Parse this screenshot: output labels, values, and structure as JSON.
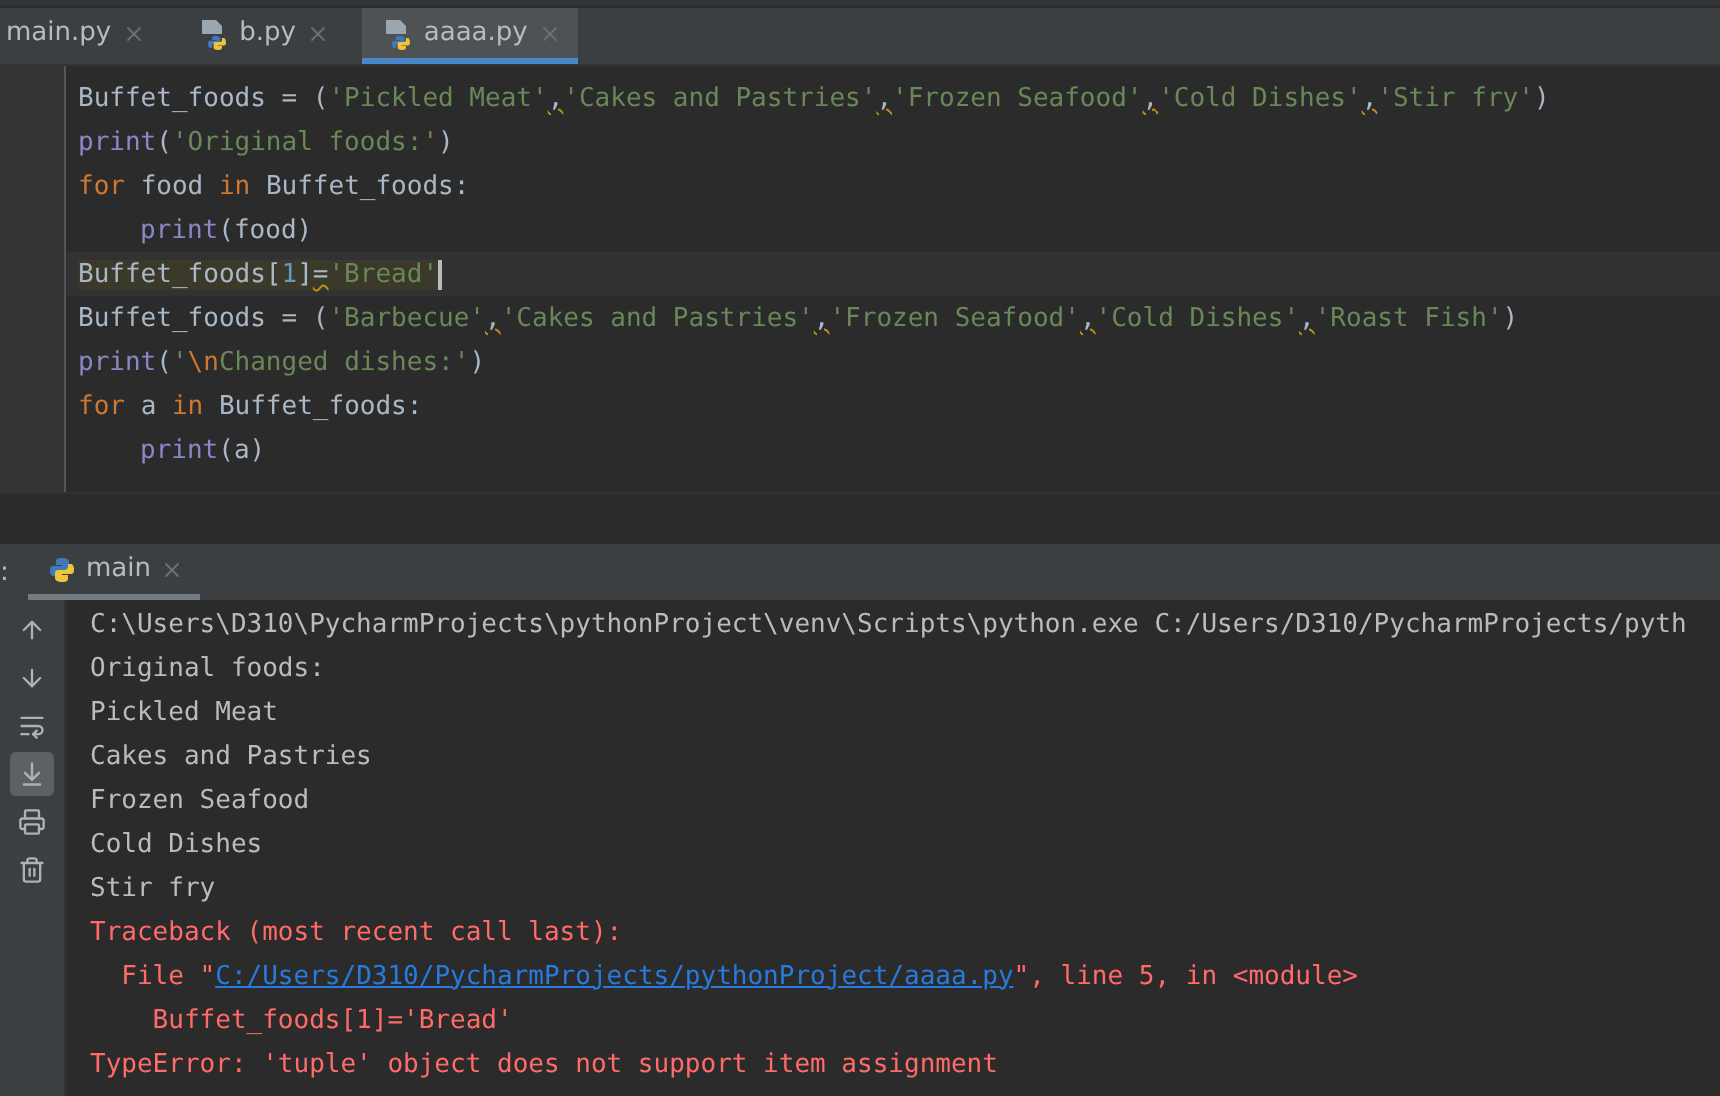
{
  "editor_tabs": [
    {
      "label": "main.py",
      "icon": false,
      "selected": false
    },
    {
      "label": "b.py",
      "icon": true,
      "selected": false
    },
    {
      "label": "aaaa.py",
      "icon": true,
      "selected": true
    }
  ],
  "code_lines": [
    {
      "current": false,
      "tokens": [
        {
          "kind": "name",
          "text": "Buffet_foods = "
        },
        {
          "kind": "paren",
          "text": "("
        },
        {
          "kind": "string",
          "text": "'Pickled Meat'"
        },
        {
          "kind": "warn",
          "text": ","
        },
        {
          "kind": "string",
          "text": "'Cakes and Pastries'"
        },
        {
          "kind": "warn",
          "text": ","
        },
        {
          "kind": "string",
          "text": "'Frozen Seafood'"
        },
        {
          "kind": "warn",
          "text": ","
        },
        {
          "kind": "string",
          "text": "'Cold Dishes'"
        },
        {
          "kind": "warn",
          "text": ","
        },
        {
          "kind": "string",
          "text": "'Stir fry'"
        },
        {
          "kind": "paren",
          "text": ")"
        }
      ]
    },
    {
      "current": false,
      "tokens": [
        {
          "kind": "builtin",
          "text": "print"
        },
        {
          "kind": "name",
          "text": "("
        },
        {
          "kind": "string",
          "text": "'Original foods:'"
        },
        {
          "kind": "name",
          "text": ")"
        }
      ]
    },
    {
      "current": false,
      "tokens": [
        {
          "kind": "keyword",
          "text": "for "
        },
        {
          "kind": "name",
          "text": "food "
        },
        {
          "kind": "keyword",
          "text": "in "
        },
        {
          "kind": "name",
          "text": "Buffet_foods:"
        }
      ],
      "children": [
        {
          "current": false,
          "tokens": [
            {
              "kind": "builtin",
              "text": "print"
            },
            {
              "kind": "name",
              "text": "(food)"
            }
          ]
        }
      ]
    },
    {
      "current": true,
      "tokens": [
        {
          "kind": "name",
          "text": "Buffet_foods["
        },
        {
          "kind": "number",
          "text": "1"
        },
        {
          "kind": "name",
          "text": "]"
        },
        {
          "kind": "warn",
          "text": "="
        },
        {
          "kind": "string",
          "text": "'Bread'"
        }
      ]
    },
    {
      "current": false,
      "tokens": [
        {
          "kind": "name",
          "text": "Buffet_foods = "
        },
        {
          "kind": "paren",
          "text": "("
        },
        {
          "kind": "string",
          "text": "'Barbecue'"
        },
        {
          "kind": "warn",
          "text": ","
        },
        {
          "kind": "string",
          "text": "'Cakes and Pastries'"
        },
        {
          "kind": "warn",
          "text": ","
        },
        {
          "kind": "string",
          "text": "'Frozen Seafood'"
        },
        {
          "kind": "warn",
          "text": ","
        },
        {
          "kind": "string",
          "text": "'Cold Dishes'"
        },
        {
          "kind": "warn",
          "text": ","
        },
        {
          "kind": "string",
          "text": "'Roast Fish'"
        },
        {
          "kind": "paren",
          "text": ")"
        }
      ]
    },
    {
      "current": false,
      "tokens": [
        {
          "kind": "builtin",
          "text": "print"
        },
        {
          "kind": "name",
          "text": "("
        },
        {
          "kind": "string",
          "text": "'"
        },
        {
          "kind": "escape",
          "text": "\\n"
        },
        {
          "kind": "string",
          "text": "Changed dishes:'"
        },
        {
          "kind": "name",
          "text": ")"
        }
      ]
    },
    {
      "current": false,
      "tokens": [
        {
          "kind": "keyword",
          "text": "for "
        },
        {
          "kind": "name",
          "text": "a "
        },
        {
          "kind": "keyword",
          "text": "in "
        },
        {
          "kind": "name",
          "text": "Buffet_foods:"
        }
      ],
      "children": [
        {
          "current": false,
          "tokens": [
            {
              "kind": "builtin",
              "text": "print"
            },
            {
              "kind": "name",
              "text": "(a)"
            }
          ]
        }
      ]
    }
  ],
  "run_panel": {
    "label": ":",
    "tab": {
      "label": "main",
      "selected": true
    }
  },
  "console_tools": [
    {
      "kind": "up",
      "on": false
    },
    {
      "kind": "down",
      "on": false
    },
    {
      "kind": "wrap",
      "on": false
    },
    {
      "kind": "scroll-end",
      "on": true
    },
    {
      "kind": "print",
      "on": false
    },
    {
      "kind": "trash",
      "on": false
    }
  ],
  "console_lines": [
    {
      "kind": "plain",
      "parts": [
        {
          "text": "C:\\Users\\D310\\PycharmProjects\\pythonProject\\venv\\Scripts\\python.exe C:/Users/D310/PycharmProjects/pyth"
        }
      ]
    },
    {
      "kind": "plain",
      "parts": [
        {
          "text": "Original foods:"
        }
      ]
    },
    {
      "kind": "plain",
      "parts": [
        {
          "text": "Pickled Meat"
        }
      ]
    },
    {
      "kind": "plain",
      "parts": [
        {
          "text": "Cakes and Pastries"
        }
      ]
    },
    {
      "kind": "plain",
      "parts": [
        {
          "text": "Frozen Seafood"
        }
      ]
    },
    {
      "kind": "plain",
      "parts": [
        {
          "text": "Cold Dishes"
        }
      ]
    },
    {
      "kind": "plain",
      "parts": [
        {
          "text": "Stir fry"
        }
      ]
    },
    {
      "kind": "error",
      "parts": [
        {
          "text": "Traceback (most recent call last):"
        }
      ]
    },
    {
      "kind": "error",
      "parts": [
        {
          "text": "  File \""
        },
        {
          "text": "C:/Users/D310/PycharmProjects/pythonProject/aaaa.py",
          "link": true
        },
        {
          "text": "\", line 5, in <module>"
        }
      ]
    },
    {
      "kind": "error",
      "parts": [
        {
          "text": "    Buffet_foods[1]='Bread'"
        }
      ]
    },
    {
      "kind": "error",
      "parts": [
        {
          "text": "TypeError: 'tuple' object does not support item assignment"
        }
      ]
    }
  ]
}
